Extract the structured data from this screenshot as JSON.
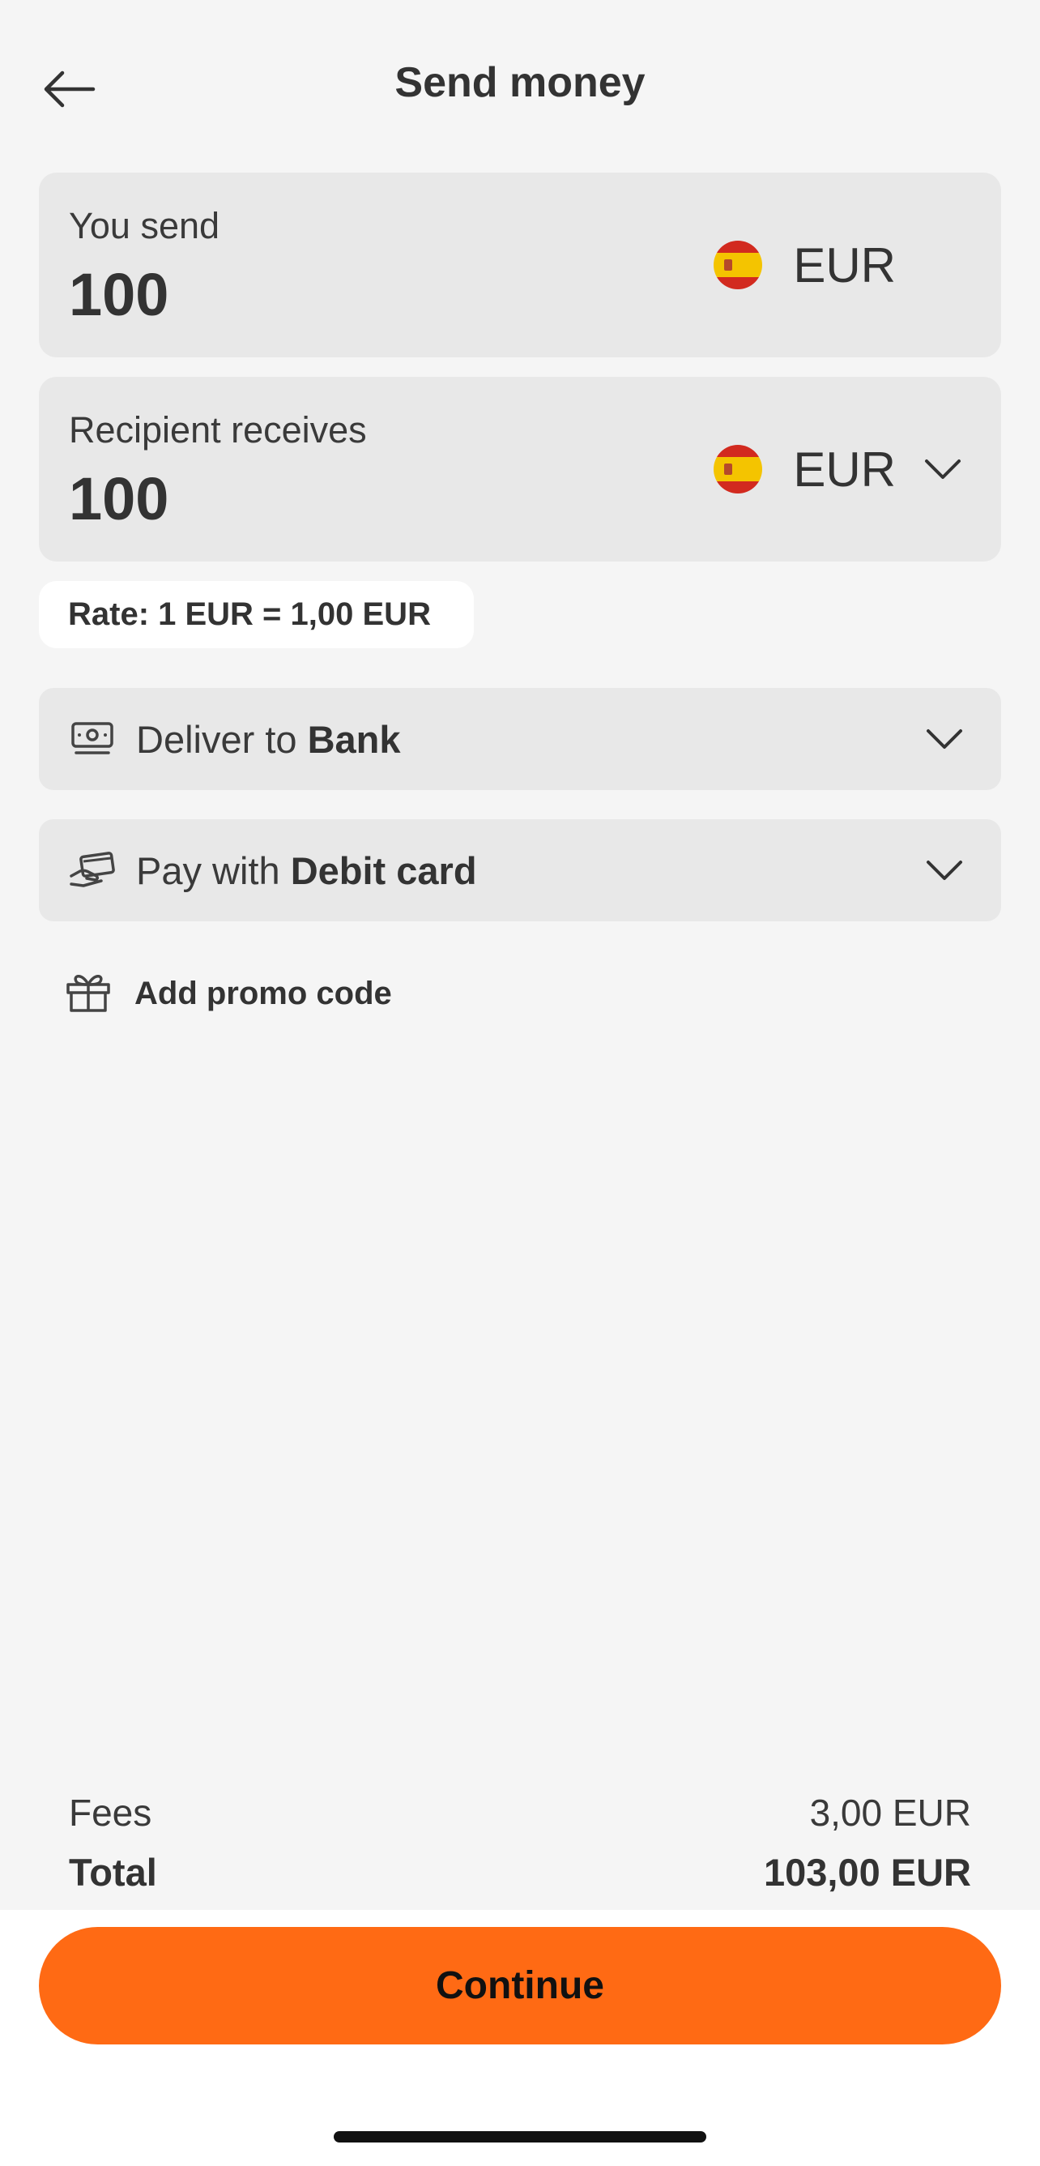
{
  "header": {
    "title": "Send money",
    "back_icon": "arrow-left-icon"
  },
  "send": {
    "label": "You send",
    "amount": "100",
    "currency": "EUR",
    "flag_icon": "spain-flag-icon"
  },
  "receive": {
    "label": "Recipient receives",
    "amount": "100",
    "currency": "EUR",
    "flag_icon": "spain-flag-icon",
    "chevron_icon": "chevron-down-icon"
  },
  "rate": {
    "text": "Rate: 1 EUR = 1,00 EUR"
  },
  "delivery": {
    "prefix": "Deliver to ",
    "method": "Bank",
    "icon": "cash-icon"
  },
  "payment": {
    "prefix": "Pay with ",
    "method": "Debit card",
    "icon": "card-hand-icon"
  },
  "promo": {
    "label": "Add promo code",
    "icon": "gift-icon"
  },
  "summary": {
    "fees_label": "Fees",
    "fees_value": "3,00 EUR",
    "total_label": "Total",
    "total_value": "103,00 EUR"
  },
  "actions": {
    "continue_label": "Continue"
  },
  "colors": {
    "accent": "#ff6a14",
    "card_bg": "#e8e8e8",
    "page_bg": "#f5f5f5"
  }
}
